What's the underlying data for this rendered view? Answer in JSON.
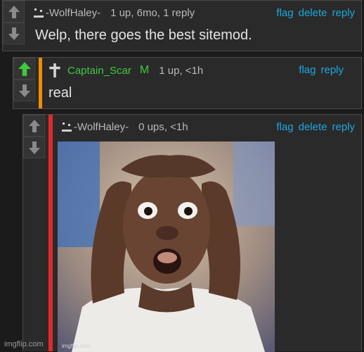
{
  "comments": [
    {
      "username": "-WolfHaley-",
      "stats": "1 up, 6mo, 1 reply",
      "actions": [
        "flag",
        "delete",
        "reply"
      ],
      "text": "Welp, there goes the best sitemod.",
      "upvoted": false,
      "stripe_color": ""
    },
    {
      "username": "Captain_Scar",
      "mod_badge": "M",
      "stats": "1 up, <1h",
      "actions": [
        "flag",
        "reply"
      ],
      "text": "real",
      "upvoted": true,
      "stripe_color": "#f08c00"
    },
    {
      "username": "-WolfHaley-",
      "stats": "0 ups, <1h",
      "actions": [
        "flag",
        "delete",
        "reply"
      ],
      "image_caption": "imgflip.com",
      "upvoted": false,
      "stripe_color": "#e02a2a"
    }
  ],
  "colors": {
    "link": "#1aa9e0",
    "mod_green": "#3ec93e",
    "upvote_active": "#3ec93e",
    "vote_inactive": "#8a8a8a"
  },
  "footer": {
    "watermark": "imgflip.com"
  }
}
